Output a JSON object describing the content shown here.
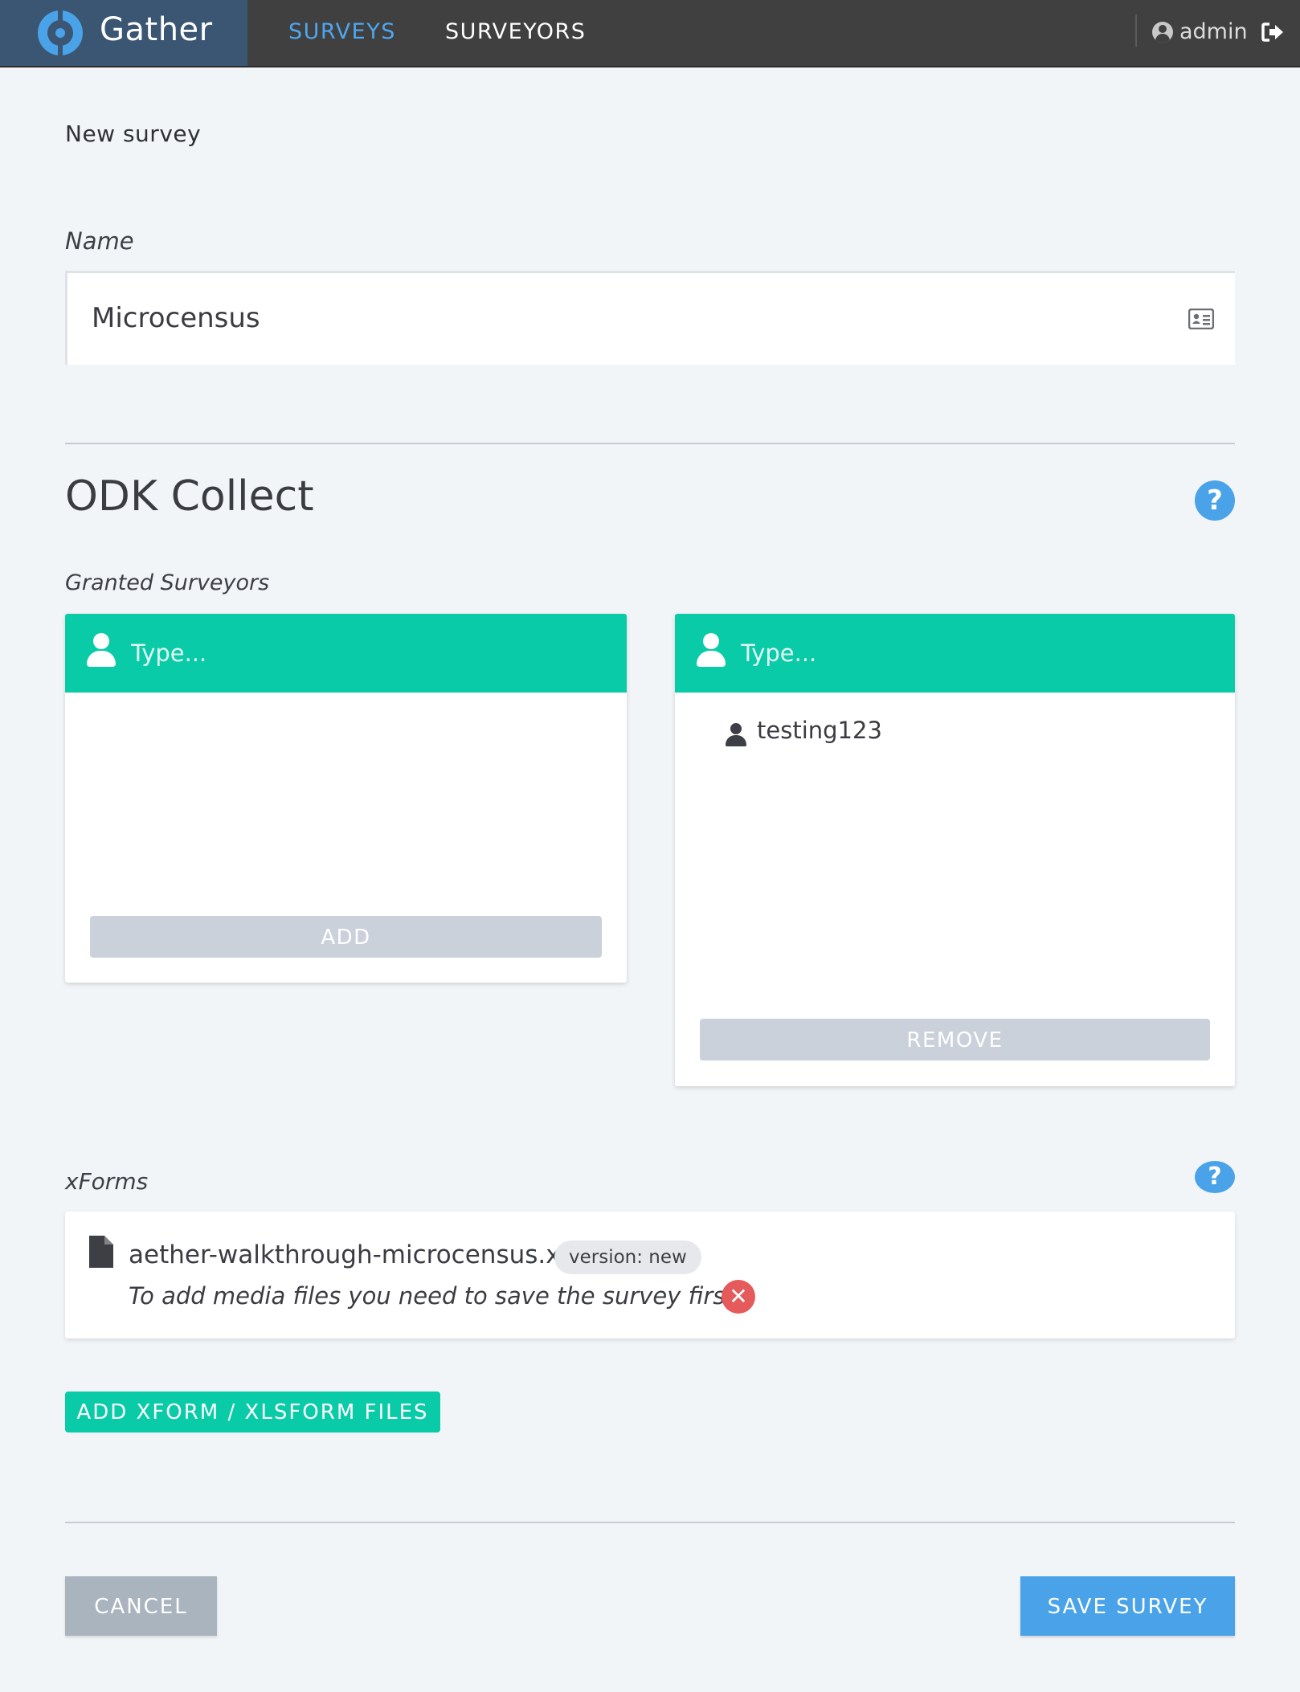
{
  "app": {
    "brand": "Gather",
    "nav": [
      {
        "label": "SURVEYS",
        "active": true
      },
      {
        "label": "SURVEYORS",
        "active": false
      }
    ],
    "user": "admin"
  },
  "page": {
    "title": "New survey"
  },
  "name_field": {
    "label": "Name",
    "value": "Microcensus"
  },
  "odk": {
    "title": "ODK Collect",
    "granted_label": "Granted Surveyors",
    "available_panel": {
      "placeholder": "Type...",
      "items": [],
      "button": "ADD"
    },
    "granted_panel": {
      "placeholder": "Type...",
      "items": [
        "testing123"
      ],
      "button": "REMOVE"
    }
  },
  "xforms": {
    "label": "xForms",
    "files": [
      {
        "name": "aether-walkthrough-microcensus.xls",
        "version": "version: new",
        "note": "To add media files you need to save the survey first"
      }
    ],
    "add_button": "ADD XFORM / XLSFORM FILES"
  },
  "actions": {
    "cancel": "CANCEL",
    "save": "SAVE SURVEY"
  },
  "colors": {
    "topbar": "#404040",
    "brand_bg": "#3a5673",
    "accent_blue": "#4aa3e8",
    "accent_green": "#0acba7",
    "danger": "#e55a5a",
    "disabled": "#cbd1da"
  }
}
